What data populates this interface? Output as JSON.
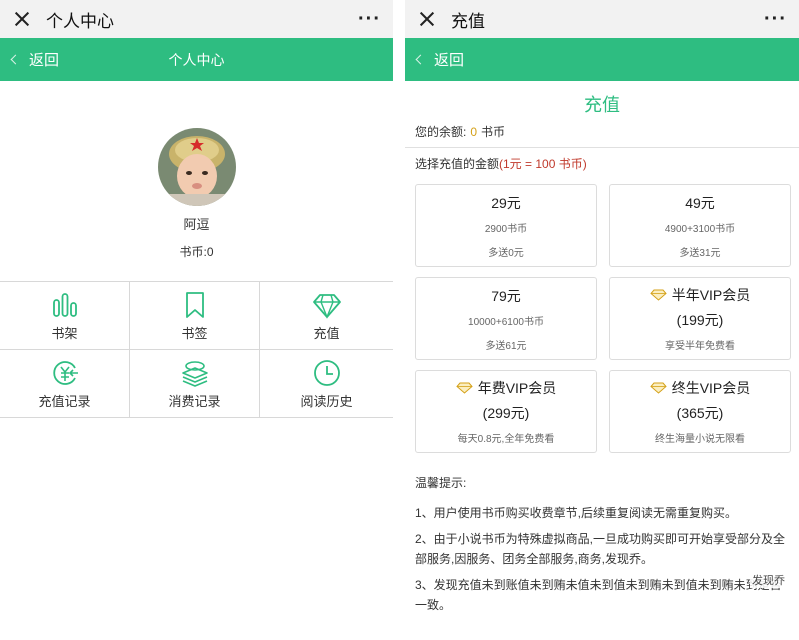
{
  "left": {
    "wechat_title": "个人中心",
    "more": "···",
    "back_label": "返回",
    "header_title": "个人中心",
    "nickname": "阿逗",
    "coins": "书币:0",
    "grid": [
      {
        "label": "书架",
        "icon": "bookshelf-icon"
      },
      {
        "label": "书签",
        "icon": "bookmark-icon"
      },
      {
        "label": "充值",
        "icon": "diamond-icon"
      },
      {
        "label": "充值记录",
        "icon": "recharge-record-icon"
      },
      {
        "label": "消费记录",
        "icon": "consume-record-icon"
      },
      {
        "label": "阅读历史",
        "icon": "clock-icon"
      }
    ]
  },
  "right": {
    "wechat_title": "充值",
    "more": "···",
    "back_label": "返回",
    "page_title": "充值",
    "balance_label": "您的余额:",
    "balance_value": "0",
    "balance_unit": "书币",
    "choose_label": "选择充值的金额",
    "rate": "(1元 = 100 书币)",
    "options": [
      {
        "price": "29元",
        "coins": "2900书币",
        "bonus": "多送0元"
      },
      {
        "price": "49元",
        "coins": "4900+3100书币",
        "bonus": "多送31元"
      },
      {
        "price": "79元",
        "coins": "10000+6100书币",
        "bonus": "多送61元"
      }
    ],
    "vip": [
      {
        "name": "半年VIP会员",
        "price": "(199元)",
        "desc": "享受半年免费看"
      },
      {
        "name": "年费VIP会员",
        "price": "(299元)",
        "desc": "每天0.8元,全年免费看"
      },
      {
        "name": "终生VIP会员",
        "price": "(365元)",
        "desc": "终生海量小说无限看"
      }
    ],
    "tips_title": "温馨提示:",
    "tips": [
      "1、用户使用书币购买收费章节,后续重复阅读无需重复购买。",
      "2、由于小说书币为特殊虚拟商品,一旦成功购买即可开始享受部分及全部服务,因服务、团务全部服务,商务,发现乔。",
      "3、发现充值未到账值未到贿未值未到值未到贿未到值未到贿未到是否一致。"
    ],
    "watermark": "发现乔"
  },
  "colors": {
    "accent": "#2ebd81",
    "gold": "#d4a017",
    "rate_red": "#c0392b"
  }
}
